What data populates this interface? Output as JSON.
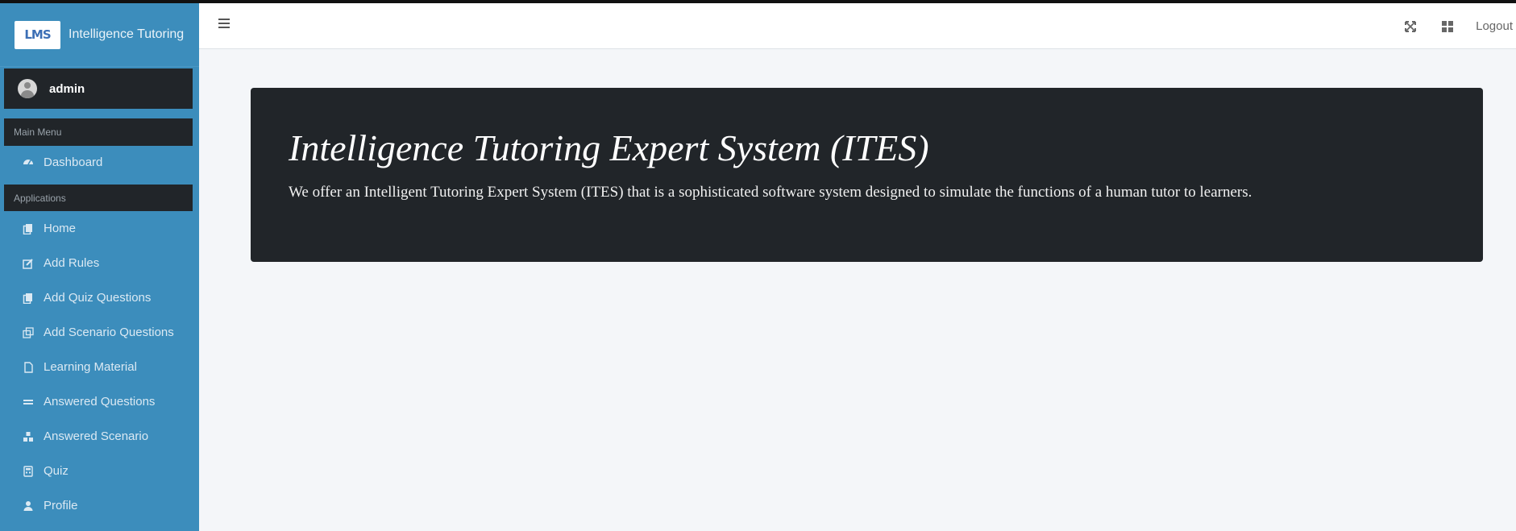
{
  "brand": {
    "logo_text": "LMS",
    "title": "Intelligence Tutoring"
  },
  "user": {
    "name": "admin"
  },
  "sidebar": {
    "main_header": "Main Menu",
    "apps_header": "Applications",
    "main_items": [
      {
        "label": "Dashboard",
        "icon": "tachometer-icon"
      }
    ],
    "app_items": [
      {
        "label": "Home",
        "icon": "copy-icon"
      },
      {
        "label": "Add Rules",
        "icon": "edit-icon"
      },
      {
        "label": "Add Quiz Questions",
        "icon": "copy-icon"
      },
      {
        "label": "Add Scenario Questions",
        "icon": "clone-icon"
      },
      {
        "label": "Learning Material",
        "icon": "file-icon"
      },
      {
        "label": "Answered Questions",
        "icon": "equals-icon"
      },
      {
        "label": "Answered Scenario",
        "icon": "cubes-icon"
      },
      {
        "label": "Quiz",
        "icon": "calculator-icon"
      },
      {
        "label": "Profile",
        "icon": "user-icon"
      }
    ]
  },
  "navbar": {
    "logout_label": "Logout"
  },
  "hero": {
    "title": "Intelligence Tutoring Expert System (ITES)",
    "text": "We offer an Intelligent Tutoring Expert System (ITES) that is a sophisticated software system designed to simulate the functions of a human tutor to learners."
  },
  "colors": {
    "sidebar": "#3c8dbc",
    "dark": "#212529",
    "background": "#f4f6f9"
  }
}
